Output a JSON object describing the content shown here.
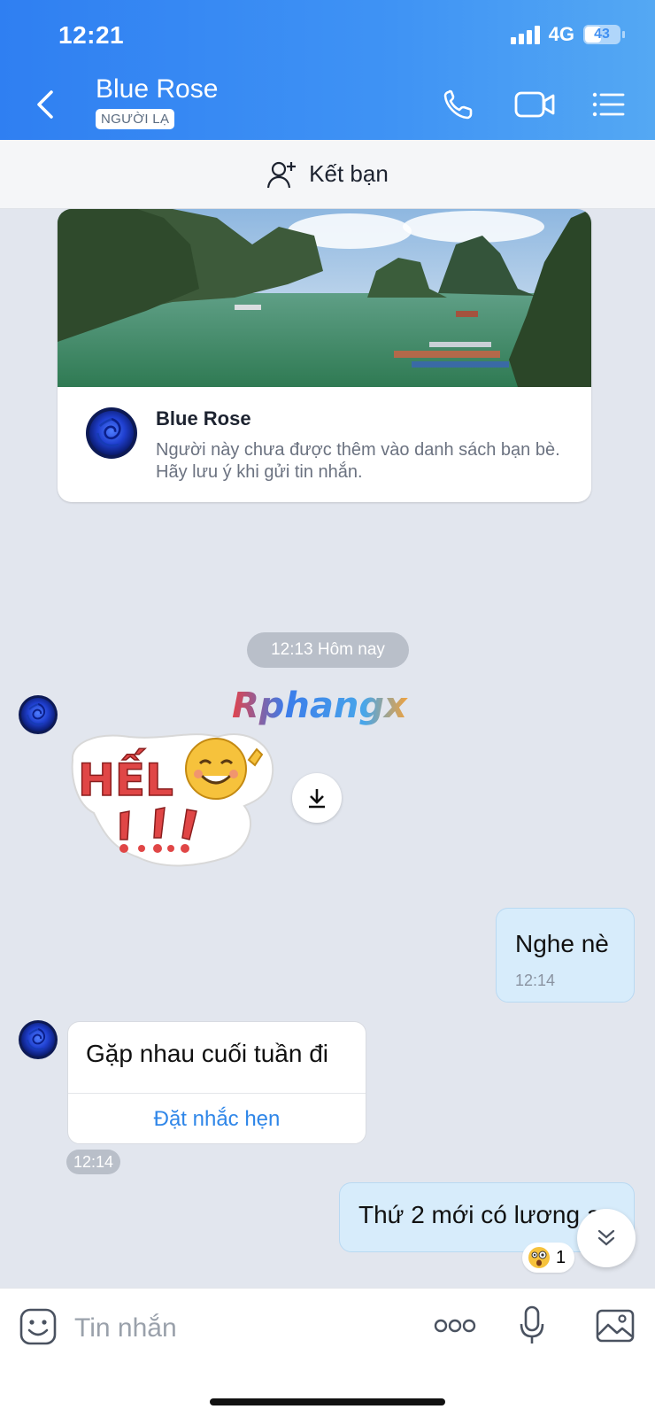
{
  "status_bar": {
    "time": "12:21",
    "network": "4G",
    "battery": "43"
  },
  "header": {
    "contact_name": "Blue Rose",
    "badge": "NGƯỜI LẠ"
  },
  "friend_bar": {
    "label": "Kết bạn"
  },
  "profile_card": {
    "name": "Blue Rose",
    "description": "Người này chưa được thêm vào danh sách bạn bè. Hãy lưu ý khi gửi tin nhắn."
  },
  "chat": {
    "time_separator": "12:13 Hôm nay",
    "watermark": "Rphangx",
    "sticker_text": "HẾLO!!!",
    "messages": [
      {
        "direction": "out",
        "text": "Nghe nè",
        "time": "12:14"
      },
      {
        "direction": "in",
        "text": "Gặp nhau cuối tuần đi",
        "action": "Đặt nhắc hẹn",
        "time": "12:14"
      },
      {
        "direction": "out",
        "text": "Thứ 2 mới có lương ạ",
        "reaction_count": "1"
      }
    ]
  },
  "input_bar": {
    "placeholder": "Tin nhắn"
  },
  "colors": {
    "header_start": "#2f7ff2",
    "header_end": "#54a8f3",
    "link_blue": "#2f86e8",
    "bubble_out": "#d7ecfb",
    "chat_bg": "#e2e6ee"
  },
  "icons": [
    "back-arrow-icon",
    "phone-icon",
    "video-call-icon",
    "menu-list-icon",
    "add-friend-icon",
    "download-icon",
    "emoji-icon",
    "more-icon",
    "microphone-icon",
    "image-icon",
    "chevron-double-down-icon",
    "surprised-emoji-icon"
  ]
}
